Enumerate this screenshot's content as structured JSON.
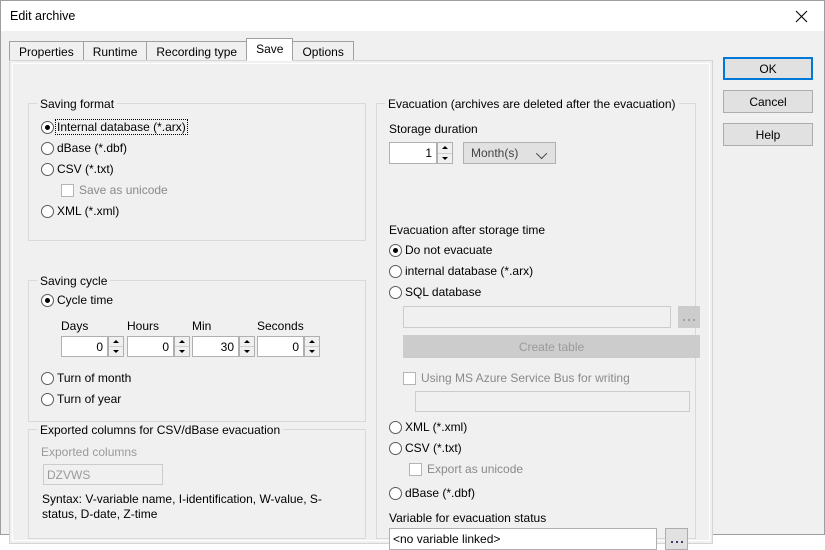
{
  "window": {
    "title": "Edit archive",
    "close_icon": "close-icon"
  },
  "tabs": [
    {
      "label": "Properties",
      "selected": false
    },
    {
      "label": "Runtime",
      "selected": false
    },
    {
      "label": "Recording type",
      "selected": false
    },
    {
      "label": "Save",
      "selected": true
    },
    {
      "label": "Options",
      "selected": false
    }
  ],
  "dialog_buttons": {
    "ok": "OK",
    "cancel": "Cancel",
    "help": "Help"
  },
  "saving_format": {
    "legend": "Saving format",
    "options": [
      {
        "label": "Internal database (*.arx)",
        "checked": true,
        "focused": true
      },
      {
        "label": "dBase (*.dbf)",
        "checked": false,
        "focused": false
      },
      {
        "label": "CSV (*.txt)",
        "checked": false,
        "focused": false
      },
      {
        "label": "XML (*.xml)",
        "checked": false,
        "focused": false
      }
    ],
    "save_as_unicode": {
      "label": "Save as unicode",
      "checked": false,
      "enabled": false
    }
  },
  "saving_cycle": {
    "legend": "Saving cycle",
    "cycle_time": {
      "label": "Cycle time",
      "checked": true
    },
    "fields": [
      {
        "label": "Days",
        "value": "0"
      },
      {
        "label": "Hours",
        "value": "0"
      },
      {
        "label": "Min",
        "value": "30"
      },
      {
        "label": "Seconds",
        "value": "0"
      }
    ],
    "turn_of_month": {
      "label": "Turn of month",
      "checked": false
    },
    "turn_of_year": {
      "label": "Turn of year",
      "checked": false
    }
  },
  "exported_columns": {
    "legend": "Exported columns for CSV/dBase evacuation",
    "field_label": "Exported columns",
    "field_value": "DZVWS",
    "syntax_hint": "Syntax: V-variable name, I-identification, W-value, S-status, D-date, Z-time"
  },
  "evacuation": {
    "legend": "Evacuation (archives are deleted after the evacuation)",
    "storage_duration_label": "Storage duration",
    "storage_duration_value": "1",
    "storage_unit_selected": "Month(s)",
    "storage_unit_options": [
      "Month(s)"
    ],
    "after_storage_label": "Evacuation after storage time",
    "options": [
      {
        "label": "Do not evacuate",
        "checked": true
      },
      {
        "label": "internal database (*.arx)",
        "checked": false
      },
      {
        "label": "SQL database",
        "checked": false
      }
    ],
    "sql_path_value": "",
    "sql_browse_label": "browse-button",
    "create_table_label": "Create table",
    "azure_checkbox": {
      "label": "Using MS Azure Service Bus for writing",
      "checked": false
    },
    "azure_value": "",
    "format_options": [
      {
        "label": "XML (*.xml)",
        "checked": false
      },
      {
        "label": "CSV (*.txt)",
        "checked": false
      },
      {
        "label": "dBase (*.dbf)",
        "checked": false
      }
    ],
    "export_as_unicode": {
      "label": "Export as unicode",
      "checked": false
    },
    "variable_status_label": "Variable for evacuation status",
    "variable_status_value": "<no variable linked>",
    "variable_browse_label": "browse-button"
  }
}
